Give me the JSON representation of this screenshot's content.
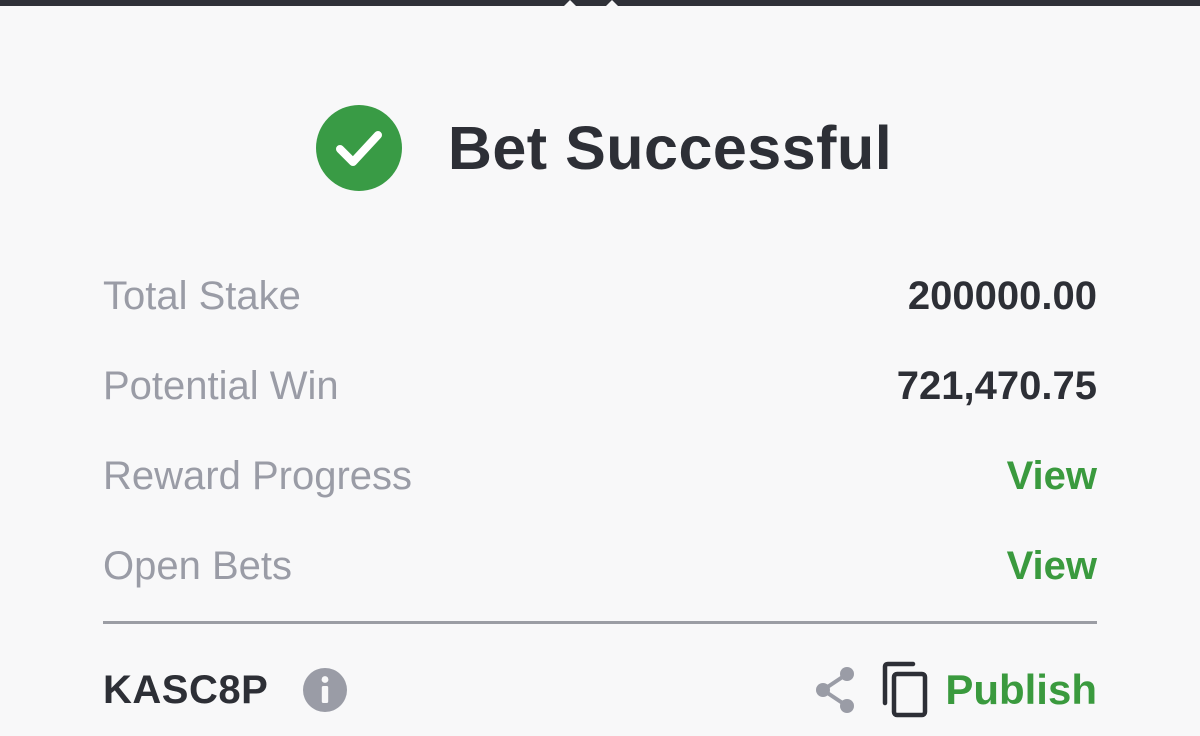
{
  "header": {
    "title": "Bet Successful",
    "status_icon": "check-circle-icon"
  },
  "details": [
    {
      "label": "Total Stake",
      "value": "200000.00",
      "type": "value"
    },
    {
      "label": "Potential Win",
      "value": "721,470.75",
      "type": "value"
    },
    {
      "label": "Reward Progress",
      "value": "View",
      "type": "link"
    },
    {
      "label": "Open Bets",
      "value": "View",
      "type": "link"
    }
  ],
  "footer": {
    "booking_code": "KASC8P",
    "info_icon": "info-icon",
    "share_icon": "share-icon",
    "copy_icon": "copy-icon",
    "publish_label": "Publish"
  },
  "colors": {
    "accent_green": "#3a9a3e",
    "check_green": "#399b45",
    "text_dark": "#2d2f36",
    "text_muted": "#9a9ca6",
    "background": "#f8f8f9"
  }
}
